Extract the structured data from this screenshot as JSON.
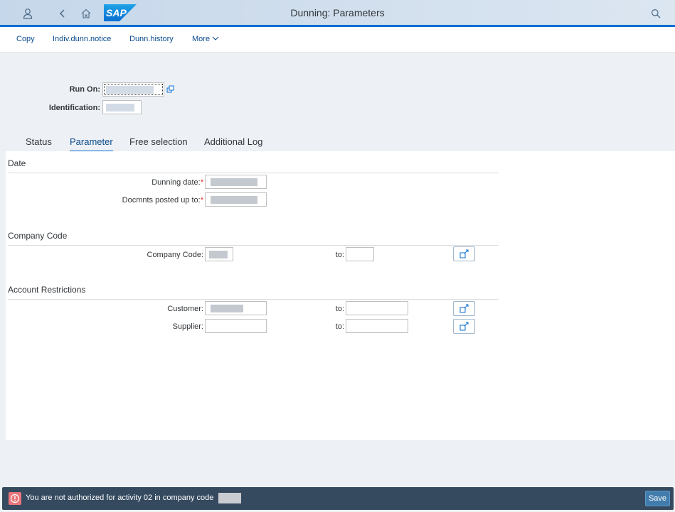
{
  "shell": {
    "title": "Dunning: Parameters",
    "logo_text": "SAP",
    "icons": [
      "user-icon",
      "back-icon",
      "home-icon",
      "search-icon"
    ]
  },
  "toolbar": {
    "copy": "Copy",
    "indiv_dunn_notice": "Indiv.dunn.notice",
    "dunn_history": "Dunn.history",
    "more": "More"
  },
  "header": {
    "run_on_label": "Run On:",
    "identification_label": "Identification:"
  },
  "tabs": [
    {
      "label": "Status",
      "active": false
    },
    {
      "label": "Parameter",
      "active": true
    },
    {
      "label": "Free selection",
      "active": false
    },
    {
      "label": "Additional Log",
      "active": false
    }
  ],
  "sections": {
    "date": {
      "title": "Date",
      "dunning_date_label": "Dunning date:",
      "docs_posted_label": "Docmnts posted up to:",
      "required_mark": "*"
    },
    "company_code": {
      "title": "Company Code",
      "company_code_label": "Company Code:",
      "to_label": "to:"
    },
    "account_restrictions": {
      "title": "Account Restrictions",
      "customer_label": "Customer:",
      "supplier_label": "Supplier:",
      "to_label": "to:"
    }
  },
  "footer": {
    "message": "You are not authorized for activity 02 in company code",
    "save_label": "Save"
  },
  "colors": {
    "accent": "#0a6ed1",
    "footer_bg": "#354a5f",
    "error": "#e9757b",
    "save_button": "#427cac"
  }
}
